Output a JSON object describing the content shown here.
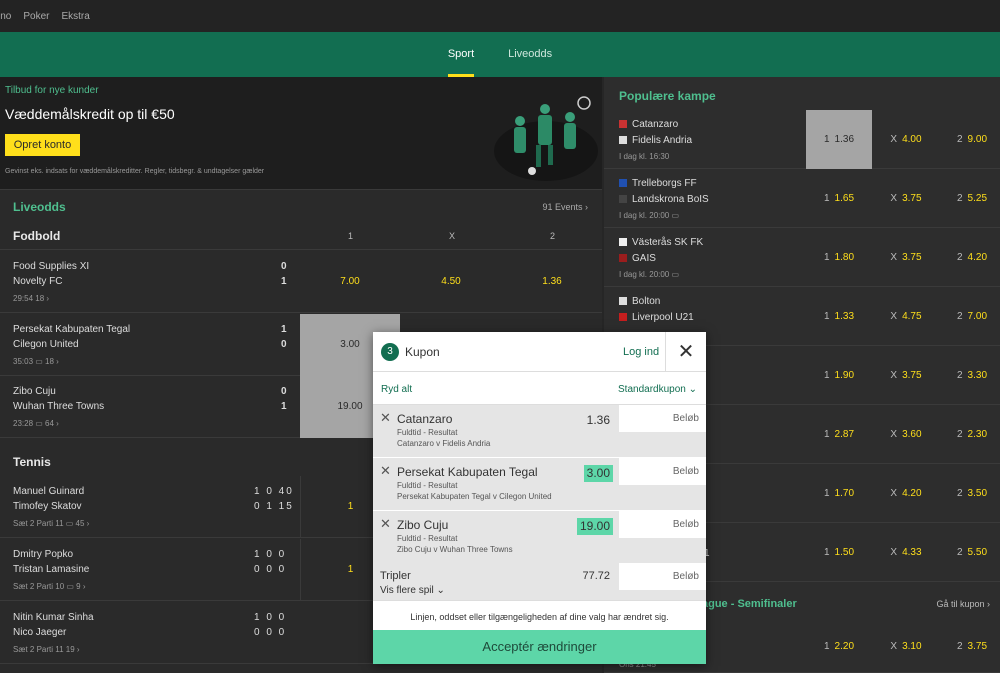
{
  "topnav": [
    "ino",
    "Poker",
    "Ekstra"
  ],
  "tabs": [
    {
      "label": "Sport",
      "active": true
    },
    {
      "label": "Liveodds",
      "active": false
    }
  ],
  "promo": {
    "kicker": "Tilbud for nye kunder",
    "title": "Væddemålskredit op til €50",
    "button": "Opret konto",
    "fine": "Gevinst eks. indsats for væddemålskreditter. Regler, tidsbegr. & undtagelser gælder"
  },
  "live": {
    "title": "Liveodds",
    "events": "91 Events ›"
  },
  "football": {
    "title": "Fodbold",
    "cols": [
      "1",
      "X",
      "2"
    ],
    "matches": [
      {
        "home": "Food Supplies XI",
        "away": "Novelty FC",
        "s1": "0",
        "s2": "1",
        "meta": "29:54   18 ›",
        "odds": [
          "7.00",
          "4.50",
          "1.36"
        ]
      },
      {
        "home": "Persekat Kabupaten Tegal",
        "away": "Cilegon United",
        "s1": "1",
        "s2": "0",
        "meta": "35:03  ▭  18 ›",
        "odds": [
          "3.00",
          "",
          ""
        ]
      },
      {
        "home": "Zibo Cuju",
        "away": "Wuhan Three Towns",
        "s1": "0",
        "s2": "1",
        "meta": "23:28  ▭  64 ›",
        "odds": [
          "19.00",
          "",
          ""
        ]
      }
    ]
  },
  "tennis": {
    "title": "Tennis",
    "matches": [
      {
        "p1": "Manuel Guinard",
        "p2": "Timofey Skatov",
        "sc1": "1 0 40",
        "sc2": "0 1 15",
        "meta": "Sæt 2 Parti 11  ▭  45 ›",
        "odd": "1"
      },
      {
        "p1": "Dmitry Popko",
        "p2": "Tristan Lamasine",
        "sc1": "1 0 0",
        "sc2": "0 0 0",
        "meta": "Sæt 2 Parti 10  ▭  9 ›",
        "odd": "1"
      },
      {
        "p1": "Nitin Kumar Sinha",
        "p2": "Nico Jaeger",
        "sc1": "1 0 0",
        "sc2": "0 0 0",
        "meta": "Sæt 2 Parti 11   19 ›",
        "odd": ""
      }
    ]
  },
  "popular": {
    "title": "Populære kampe",
    "matches": [
      {
        "home": "Catanzaro",
        "away": "Fidelis Andria",
        "time": "I dag kl. 16:30",
        "o1": "1.36",
        "ox": "4.00",
        "o2": "9.00",
        "sel": true
      },
      {
        "home": "Trelleborgs FF",
        "away": "Landskrona BoIS",
        "time": "I dag kl. 20:00  ▭",
        "o1": "1.65",
        "ox": "3.75",
        "o2": "5.25",
        "sel": false
      },
      {
        "home": "Västerås SK FK",
        "away": "GAIS",
        "time": "I dag kl. 20:00  ▭",
        "o1": "1.80",
        "ox": "3.75",
        "o2": "4.20",
        "sel": false
      },
      {
        "home": "Bolton",
        "away": "Liverpool U21",
        "time": "",
        "o1": "1.33",
        "ox": "4.75",
        "o2": "7.00",
        "sel": false
      },
      {
        "home": "",
        "away": "",
        "time": "",
        "o1": "1.90",
        "ox": "3.75",
        "o2": "3.30",
        "sel": false
      },
      {
        "home": "",
        "away": "",
        "time": "",
        "o1": "2.87",
        "ox": "3.60",
        "o2": "2.30",
        "sel": false
      },
      {
        "home": "",
        "away": "",
        "time": "",
        "o1": "1.70",
        "ox": "4.20",
        "o2": "3.50",
        "sel": false
      },
      {
        "home": "",
        "away": "1",
        "time": "",
        "o1": "1.50",
        "ox": "4.33",
        "o2": "5.50",
        "sel": false
      }
    ],
    "league": "ague - Semifinaler",
    "league_link": "Gå til kupon ›",
    "last": {
      "time": "Ons 21:45",
      "o1": "2.20",
      "ox": "3.10",
      "o2": "3.75"
    }
  },
  "coupon": {
    "count": "3",
    "title": "Kupon",
    "login": "Log ind",
    "close": "✕",
    "clear": "Ryd alt",
    "type": "Standardkupon ⌄",
    "legs": [
      {
        "name": "Catanzaro",
        "market": "Fuldtid - Resultat",
        "event": "Catanzaro v Fidelis Andria",
        "odds": "1.36",
        "changed": false,
        "stake": "Beløb"
      },
      {
        "name": "Persekat Kabupaten Tegal",
        "market": "Fuldtid - Resultat",
        "event": "Persekat Kabupaten Tegal v Cilegon United",
        "odds": "3.00",
        "changed": true,
        "stake": "Beløb"
      },
      {
        "name": "Zibo Cuju",
        "market": "Fuldtid - Resultat",
        "event": "Zibo Cuju v Wuhan Three Towns",
        "odds": "19.00",
        "changed": true,
        "stake": "Beløb"
      }
    ],
    "triple": {
      "label": "Tripler",
      "more": "Vis flere spil ⌄",
      "odds": "77.72",
      "stake": "Beløb"
    },
    "message": "Linjen, oddset eller tilgængeligheden af dine valg har ændret sig.",
    "accept": "Acceptér ændringer"
  },
  "colors": {
    "brand": "#126e51",
    "accent": "#ffdf1b",
    "changed": "#5dd6a8"
  }
}
